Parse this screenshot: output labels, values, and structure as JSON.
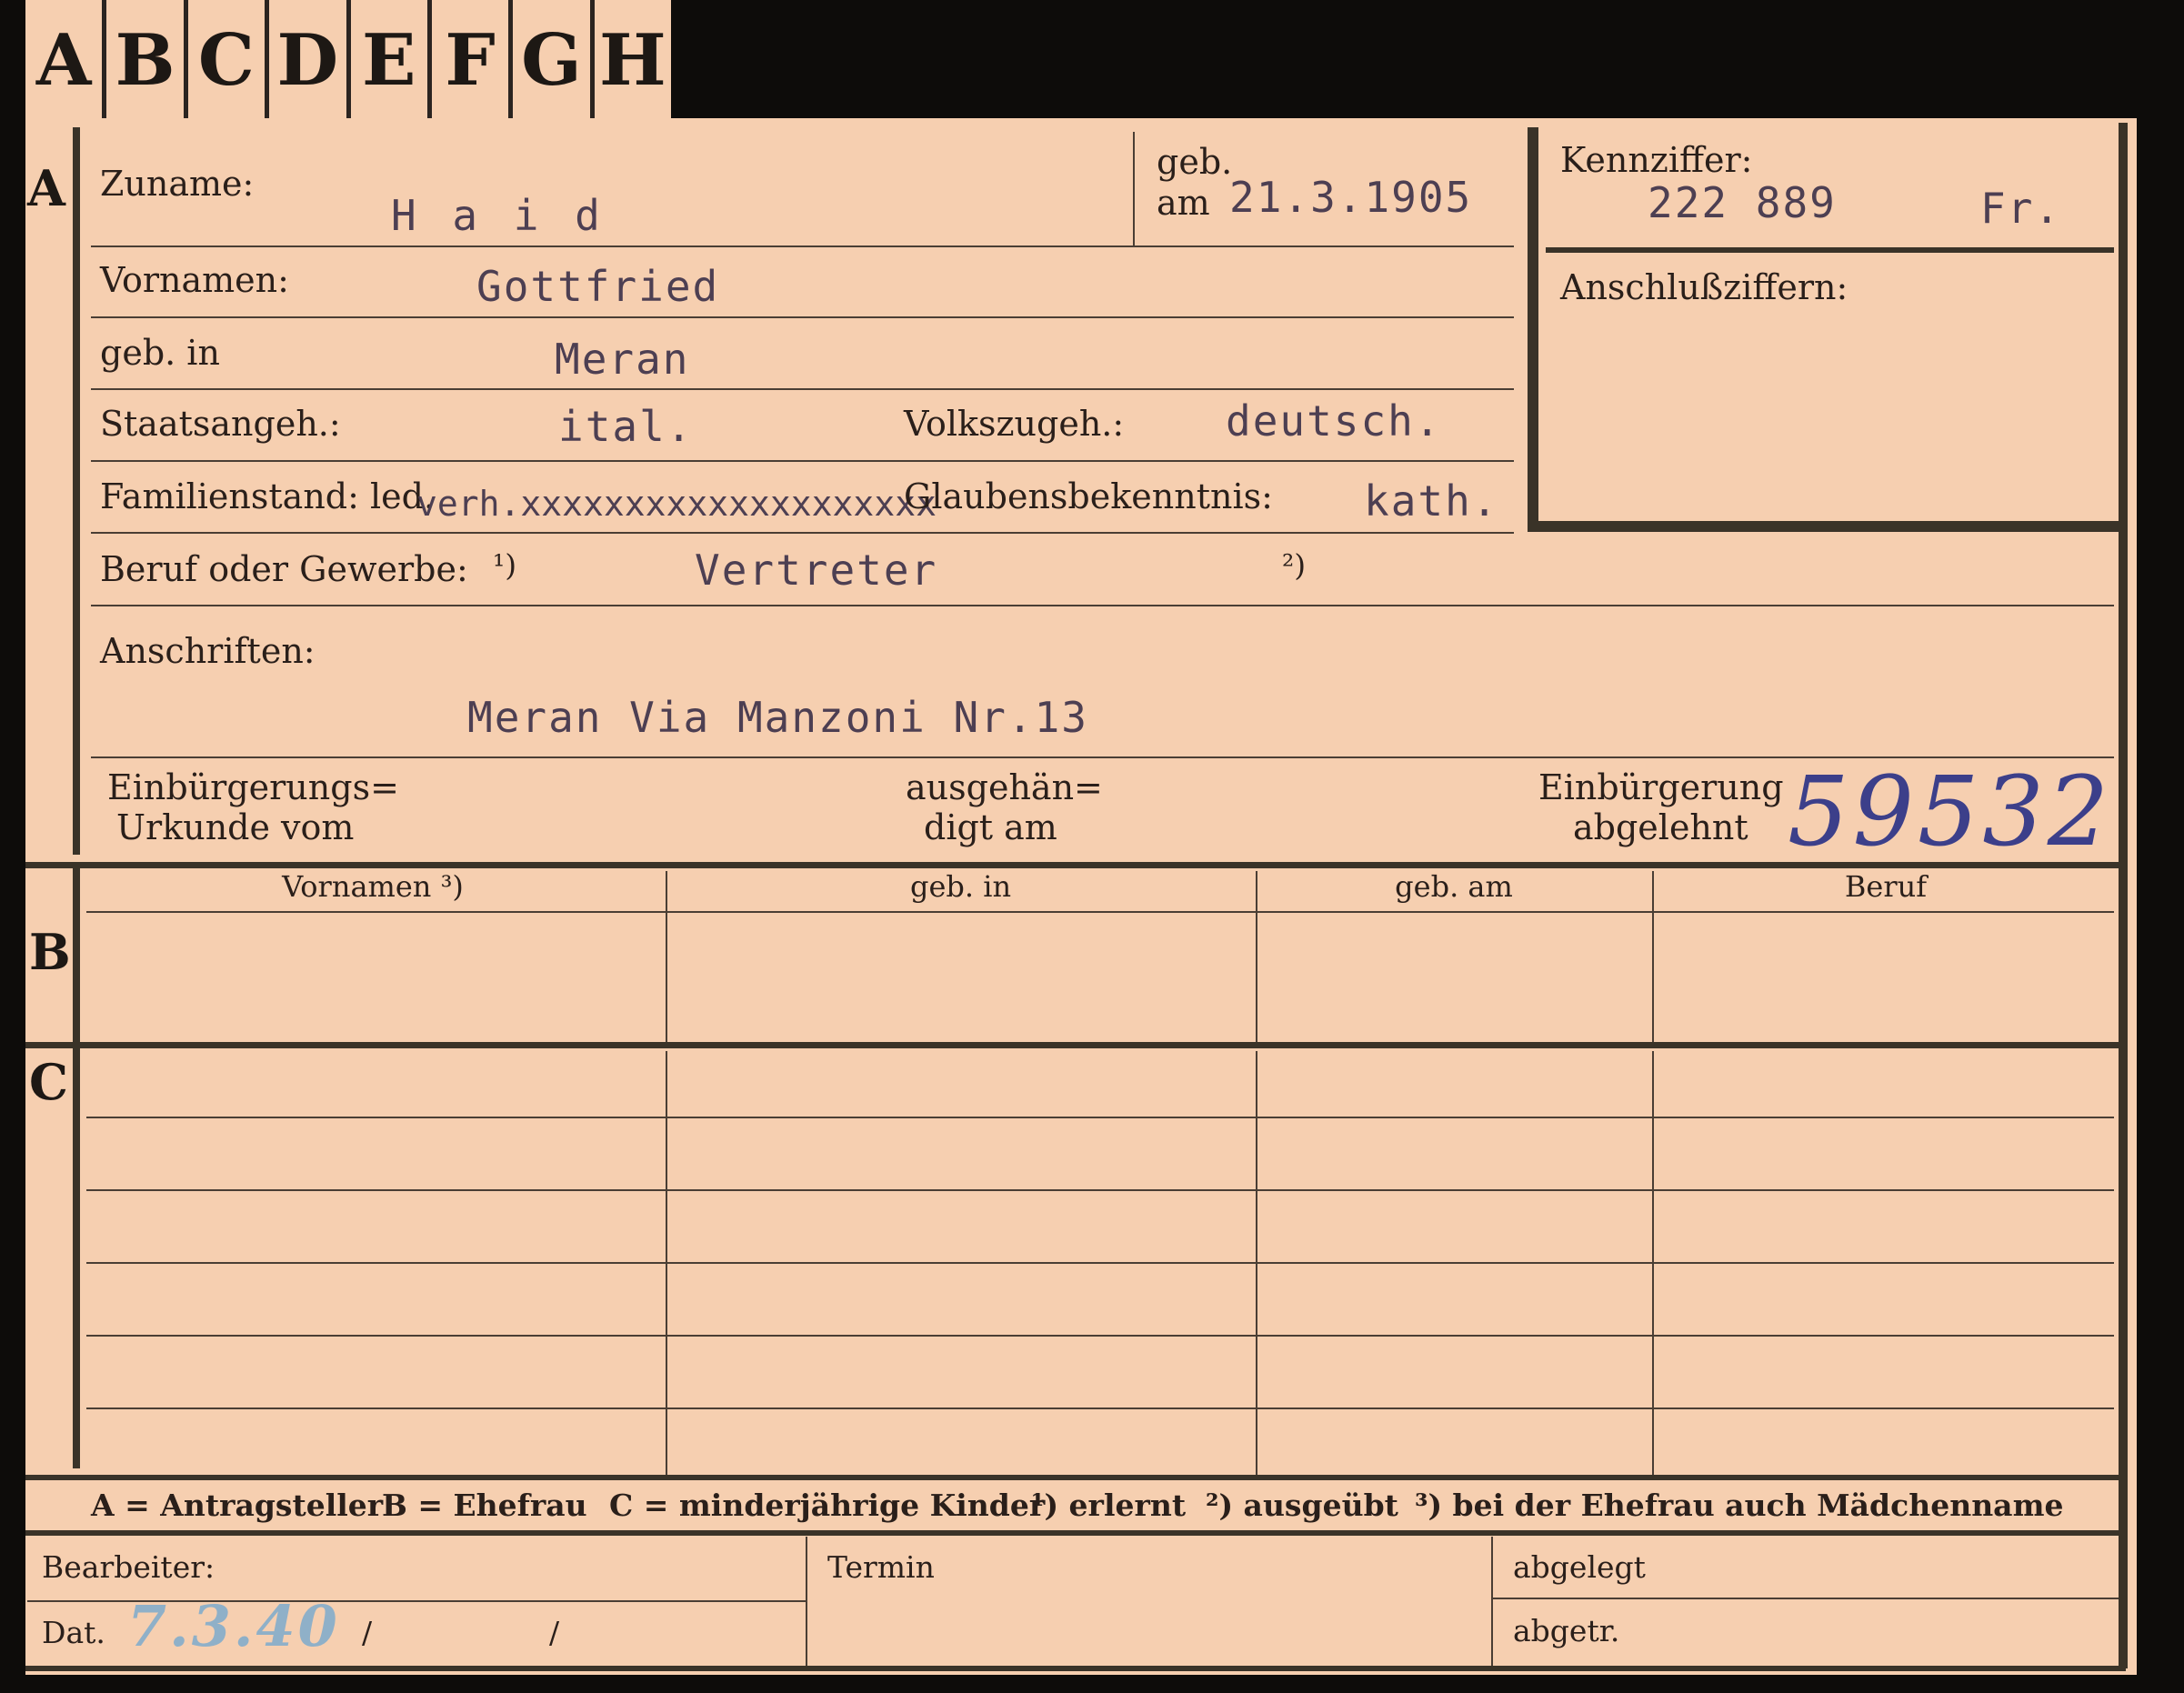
{
  "tabs": [
    "A",
    "B",
    "C",
    "D",
    "E",
    "F",
    "G",
    "H"
  ],
  "sections": {
    "a": "A",
    "b": "B",
    "c": "C"
  },
  "labels": {
    "zuname": "Zuname:",
    "geb": "geb.",
    "am": "am",
    "vornamen": "Vornamen:",
    "geb_in": "geb. in",
    "staatsangeh": "Staatsangeh.:",
    "volkszugeh": "Volkszugeh.:",
    "familienstand": "Familienstand: led.",
    "glaubensbekenntnis": "Glaubensbekenntnis:",
    "beruf": "Beruf oder Gewerbe:",
    "note1": "¹)",
    "note2": "²)",
    "anschriften": "Anschriften:",
    "einbuergerungs_1": "Einbürgerungs=",
    "einbuergerungs_2": "Urkunde vom",
    "ausgehaen_1": "ausgehän=",
    "ausgehaen_2": "digt am",
    "einbuergerung_1": "Einbürgerung",
    "einbuergerung_2": "abgelehnt",
    "kennziffer": "Kennziffer:",
    "anschlussziffern": "Anschlußziffern:"
  },
  "values": {
    "zuname": "H a i d",
    "geb_am": "21.3.1905",
    "vornamen": "Gottfried",
    "geb_in": "Meran",
    "staatsangeh": "ital.",
    "volkszugeh": "deutsch.",
    "familienstand_struck": "verh.xxxxxxxxxxxxxxxxxxxx",
    "glaubensbekenntnis": "kath.",
    "beruf": "Vertreter",
    "anschrift": "Meran Via Manzoni Nr.13",
    "kennziffer": "222 889",
    "kennziffer_suffix": "Fr.",
    "stamp_number": "59532"
  },
  "table_columns": [
    "Vornamen ³)",
    "geb. in",
    "geb. am",
    "Beruf"
  ],
  "legend": {
    "a": "A = Antragsteller",
    "b": "B = Ehefrau",
    "c": "C = minderjährige Kinder",
    "n1": "¹) erlernt",
    "n2": "²) ausgeübt",
    "n3": "³) bei der Ehefrau auch Mädchenname"
  },
  "footer": {
    "bearbeiter": "Bearbeiter:",
    "dat": "Dat.",
    "dat_value": "7.3.40",
    "slash": "/",
    "termin": "Termin",
    "abgelegt": "abgelegt",
    "abgetr": "abgetr."
  },
  "colors": {
    "card": "#f6cfb0",
    "ink_typed": "#4d3f52",
    "ink_stamp": "#3c3f8a",
    "pencil": "#8fb0c8"
  }
}
